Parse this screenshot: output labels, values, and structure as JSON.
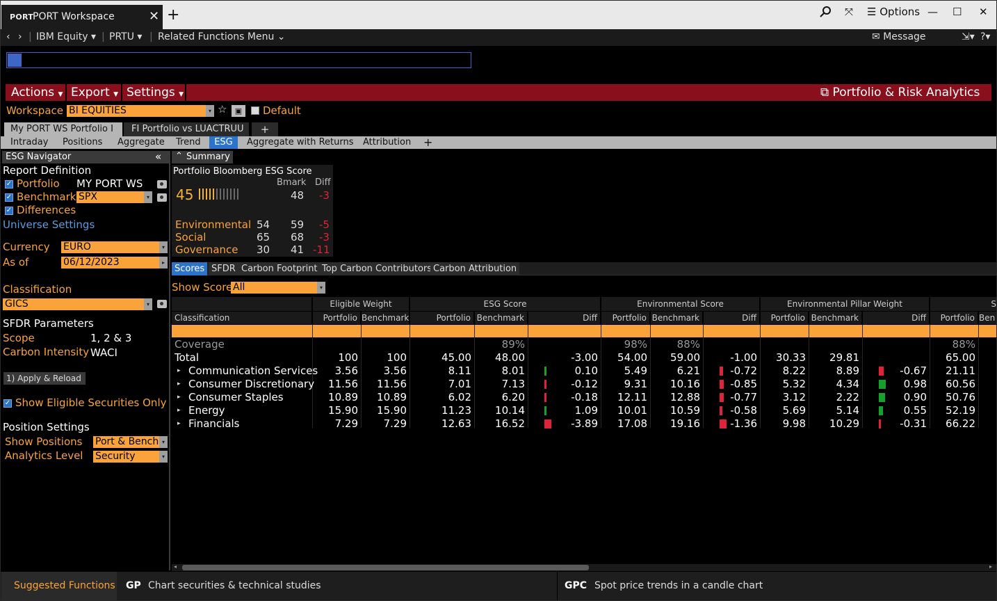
{
  "window": {
    "tab_code": "PORT",
    "tab_title": "PORT Workspace",
    "options_label": "Options"
  },
  "nav": {
    "security": "IBM Equity",
    "function": "PRTU",
    "related": "Related Functions Menu",
    "message": "Message"
  },
  "menu": {
    "actions": "Actions",
    "export": "Export",
    "settings": "Settings",
    "app_title": "Portfolio & Risk Analytics"
  },
  "workspace": {
    "label": "Workspace",
    "value": "BI EQUITIES",
    "default_label": "Default"
  },
  "portfolio_tabs": [
    "My PORT WS Portfolio I",
    "FI Portfolio vs LUACTRUU"
  ],
  "view_tabs": [
    "Intraday",
    "Positions",
    "Aggregate",
    "Trend",
    "ESG",
    "Aggregate with Returns",
    "Attribution"
  ],
  "navigator": {
    "title": "ESG Navigator",
    "report_definition": "Report Definition",
    "portfolio_label": "Portfolio",
    "portfolio_value": "MY PORT WS",
    "benchmark_label": "Benchmark",
    "benchmark_value": "SPX",
    "differences_label": "Differences",
    "universe_settings": "Universe Settings",
    "currency_label": "Currency",
    "currency_value": "EURO",
    "asof_label": "As of",
    "asof_value": "06/12/2023",
    "classification_label": "Classification",
    "classification_value": "GICS",
    "sfdr_title": "SFDR Parameters",
    "scope_label": "Scope",
    "scope_value": "1, 2 & 3",
    "carbon_label": "Carbon Intensity",
    "carbon_value": "WACI",
    "apply_button": "1) Apply & Reload",
    "show_eligible": "Show Eligible Securities Only",
    "position_settings": "Position Settings",
    "show_positions_label": "Show Positions",
    "show_positions_value": "Port & Bench",
    "analytics_level_label": "Analytics Level",
    "analytics_level_value": "Security"
  },
  "summary": {
    "header": "Summary",
    "title": "Portfolio Bloomberg ESG Score",
    "bmark_label": "Bmark",
    "diff_label": "Diff",
    "score": "45",
    "bmark": "48",
    "diff": "-3",
    "score_gauge_level": 0.45,
    "pillars": [
      {
        "name": "Environmental",
        "port": "54",
        "bmark": "59",
        "diff": "-5"
      },
      {
        "name": "Social",
        "port": "65",
        "bmark": "68",
        "diff": "-3"
      },
      {
        "name": "Governance",
        "port": "30",
        "bmark": "41",
        "diff": "-11"
      }
    ]
  },
  "sub_tabs": [
    "Scores",
    "SFDR",
    "Carbon Footprint",
    "Top Carbon Contributors",
    "Carbon Attribution"
  ],
  "show_score": {
    "label": "Show Score",
    "value": "All"
  },
  "table": {
    "groups": [
      "Eligible Weight",
      "ESG Score",
      "Environmental Score",
      "Environmental Pillar Weight",
      "S"
    ],
    "sub_headers": [
      "Classification",
      "Portfolio",
      "Benchmark",
      "Portfolio",
      "Benchmark",
      "Diff",
      "Portfolio",
      "Benchmark",
      "Diff",
      "Portfolio",
      "Benchmark",
      "Diff",
      "Portfolio",
      "Ben"
    ],
    "coverage": {
      "label": "Coverage",
      "esg_bmark": "89%",
      "env_port": "98%",
      "env_bmark": "88%",
      "s_port": "88%"
    },
    "total": {
      "label": "Total",
      "cells": [
        "100",
        "100",
        "45.00",
        "48.00",
        "-3.00",
        "54.00",
        "59.00",
        "-1.00",
        "30.33",
        "29.81",
        "",
        "65.00"
      ]
    },
    "rows": [
      {
        "label": "Communication Services",
        "cells": [
          "3.56",
          "3.56",
          "8.11",
          "8.01",
          "0.10",
          "5.49",
          "6.21",
          "-0.72",
          "8.22",
          "8.89",
          "-0.67",
          "21.11"
        ],
        "esg_diff": 0.1,
        "env_diff": -0.72,
        "pillar_diff": -0.67
      },
      {
        "label": "Consumer Discretionary",
        "cells": [
          "11.56",
          "11.56",
          "7.01",
          "7.13",
          "-0.12",
          "9.31",
          "10.16",
          "-0.85",
          "5.32",
          "4.34",
          "0.98",
          "60.56"
        ],
        "esg_diff": -0.12,
        "env_diff": -0.85,
        "pillar_diff": 0.98
      },
      {
        "label": "Consumer Staples",
        "cells": [
          "10.89",
          "10.89",
          "6.02",
          "6.20",
          "-0.18",
          "12.11",
          "12.88",
          "-0.77",
          "3.12",
          "2.22",
          "0.90",
          "50.76"
        ],
        "esg_diff": -0.18,
        "env_diff": -0.77,
        "pillar_diff": 0.9
      },
      {
        "label": "Energy",
        "cells": [
          "15.90",
          "15.90",
          "11.23",
          "10.14",
          "1.09",
          "10.01",
          "10.59",
          "-0.58",
          "5.69",
          "5.14",
          "0.55",
          "52.19"
        ],
        "esg_diff": 1.09,
        "env_diff": -0.58,
        "pillar_diff": 0.55
      },
      {
        "label": "Financials",
        "cells": [
          "7.29",
          "7.29",
          "12.63",
          "16.52",
          "-3.89",
          "17.08",
          "19.16",
          "-1.36",
          "9.98",
          "10.29",
          "-0.31",
          "66.22"
        ],
        "esg_diff": -3.89,
        "env_diff": -1.36,
        "pillar_diff": -0.31
      }
    ]
  },
  "footer": {
    "suggested": "Suggested Functions",
    "f1_code": "GP",
    "f1_desc": "Chart securities & technical studies",
    "f2_code": "GPC",
    "f2_desc": "Spot price trends in a candle chart"
  },
  "colors": {
    "orange": "#f9a33a",
    "red_bar": "#8a0f1d",
    "accent_blue": "#2c74c9",
    "neg": "#e0223a",
    "pos": "#18a02e"
  }
}
